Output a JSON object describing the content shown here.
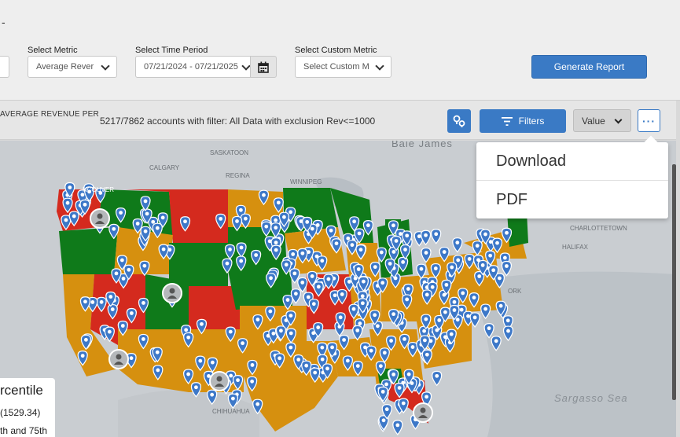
{
  "header": {
    "dash": "-",
    "metric_label": "Select Metric",
    "metric_value": "Average Rever",
    "time_label": "Select Time Period",
    "time_value": "07/21/2024 - 07/21/2025",
    "custom_label": "Select Custom Metric",
    "custom_value": "Select Custom M",
    "generate_label": "Generate Report"
  },
  "toolbar": {
    "metric_title": "AVERAGE REVENUE PER",
    "accounts_text": "5217/7862 accounts with filter: All Data with exclusion Rev<=1000",
    "filters_label": "Filters",
    "value_select": "Value",
    "more_label": "···"
  },
  "dropdown": {
    "items": [
      {
        "label": "Download"
      },
      {
        "label": "PDF"
      }
    ]
  },
  "map": {
    "labels": {
      "baie_james": "Baie James",
      "saskatoon": "SASKATOON",
      "calgary": "CALGARY",
      "regina": "REGINA",
      "winnipeg": "WINNIPEG",
      "vancouver": "NCOUVER",
      "charlottetown": "CHARLOTTETOWN",
      "halifax": "HALIFAX",
      "ork": "ORK",
      "chihuahua": "CHIHUAHUA",
      "sargasso": "Sargasso Sea"
    },
    "colors": {
      "red": "#d42a1e",
      "green": "#0f7a1a",
      "orange": "#d6900f",
      "marker": "#3d78c8"
    }
  },
  "legend": {
    "title": "rcentile",
    "line1": "(1529.34)",
    "line2": "th and 75th"
  }
}
